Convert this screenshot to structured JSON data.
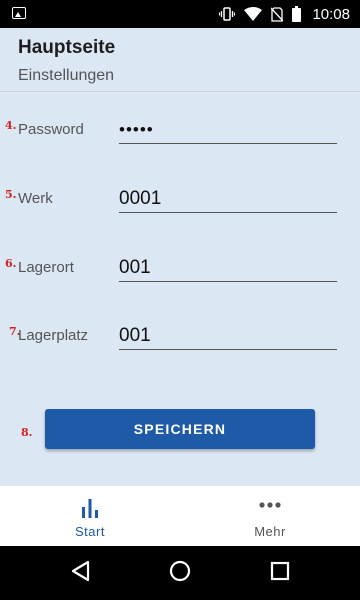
{
  "status_bar": {
    "time": "10:08",
    "icons": [
      "image-icon",
      "vibrate-icon",
      "wifi-icon",
      "no-sim-icon",
      "battery-icon"
    ]
  },
  "header": {
    "title": "Hauptseite",
    "subtitle": "Einstellungen"
  },
  "form": {
    "fields": [
      {
        "number": "4.",
        "label": "Password",
        "value": "•••••"
      },
      {
        "number": "5.",
        "label": "Werk",
        "value": "0001"
      },
      {
        "number": "6.",
        "label": "Lagerort",
        "value": "001"
      },
      {
        "number": "7.",
        "label": "Lagerplatz",
        "value": "001"
      }
    ],
    "save_number": "8.",
    "save_label": "SPEICHERN"
  },
  "bottom_nav": {
    "items": [
      {
        "label": "Start",
        "icon": "bar-chart-icon",
        "active": true
      },
      {
        "label": "Mehr",
        "icon": "more-dots-icon",
        "active": false
      }
    ]
  },
  "colors": {
    "background": "#dce7f4",
    "accent": "#1e5aa8",
    "marker_red": "#d42020"
  }
}
